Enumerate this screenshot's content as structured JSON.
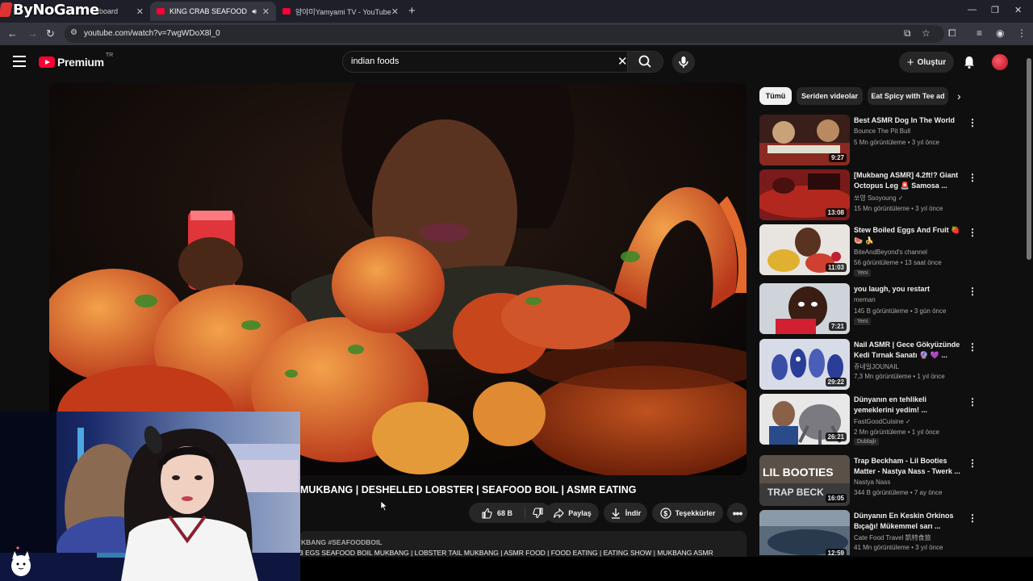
{
  "watermark": "ByNoGame",
  "browser": {
    "tabs": [
      {
        "label": "nboard"
      },
      {
        "label": "KING CRAB SEAFOOD BOIL"
      },
      {
        "label": "얌야미Yamyami TV - YouTube"
      }
    ],
    "url": "youtube.com/watch?v=7wgWDoX8l_0"
  },
  "youtube": {
    "logo_text": "Premium",
    "region": "TR",
    "search_query": "indian foods",
    "create_label": "Oluştur"
  },
  "chips": [
    "Tümü",
    "Seriden videolar",
    "Eat Spicy with Tee ad"
  ],
  "recommendations": [
    {
      "title": "Best ASMR Dog In The World",
      "channel": "Bounce The Pit Bull",
      "meta": "5 Mn görüntüleme • 3 yıl önce",
      "duration": "9:27",
      "badge": ""
    },
    {
      "title": "[Mukbang ASMR] 4.2ft!? Giant Octopus Leg 🚨 Samosa ...",
      "channel": "쏘영 Ssoyoung ✓",
      "meta": "15 Mn görüntüleme • 3 yıl önce",
      "duration": "13:08",
      "badge": ""
    },
    {
      "title": "Stew Boiled Eggs And Fruit 🍓 🍉 🍌",
      "channel": "BiteAndBeyond's channel",
      "meta": "56 görüntüleme • 13 saat önce",
      "duration": "11:03",
      "badge": "Yeni"
    },
    {
      "title": "you laugh, you restart",
      "channel": "meman",
      "meta": "145 B görüntüleme • 3 gün önce",
      "duration": "7:21",
      "badge": "Yeni"
    },
    {
      "title": "Nail ASMR | Gece Gökyüzünde Kedi Tırnak Sanatı 🔮 💜 ...",
      "channel": "쥬네일JOUNAIL",
      "meta": "7,3 Mn görüntüleme • 1 yıl önce",
      "duration": "29:22",
      "badge": ""
    },
    {
      "title": "Dünyanın en tehlikeli yemeklerini yedim! ...",
      "channel": "FastGoodCuisine ✓",
      "meta": "2 Mn görüntüleme • 1 yıl önce",
      "duration": "26:21",
      "badge": "Dublajlı"
    },
    {
      "title": "Trap Beckham - Lil Booties Matter - Nastya Nass - Twerk ...",
      "channel": "Nastya Nass",
      "meta": "344 B görüntüleme • 7 ay önce",
      "duration": "16:05",
      "badge": ""
    },
    {
      "title": "Dünyanın En Keskin Orkinos Bıçağı! Mükemmel sarı ...",
      "channel": "Cate Food Travel 凱特食旅",
      "meta": "41 Mn görüntüleme • 3 yıl önce",
      "duration": "12:59",
      "badge": ""
    }
  ],
  "video": {
    "title": "MUKBANG | DESHELLED LOBSTER | SEAFOOD BOIL | ASMR EATING",
    "likes": "68 B",
    "share_label": "Paylaş",
    "download_label": "İndir",
    "thanks_label": "Teşekkürler",
    "desc_tags": "KBANG #SEAFOODBOIL",
    "desc_text": "3 EGS SEAFOOD BOIL MUKBANG | LOBSTER TAIL MUKBANG | ASMR FOOD | FOOD EATING | EATING SHOW | MUKBANG ASMR"
  },
  "colors": {
    "brand_red": "#ff0033",
    "bg": "#0f0f0f",
    "surface": "#272727"
  }
}
